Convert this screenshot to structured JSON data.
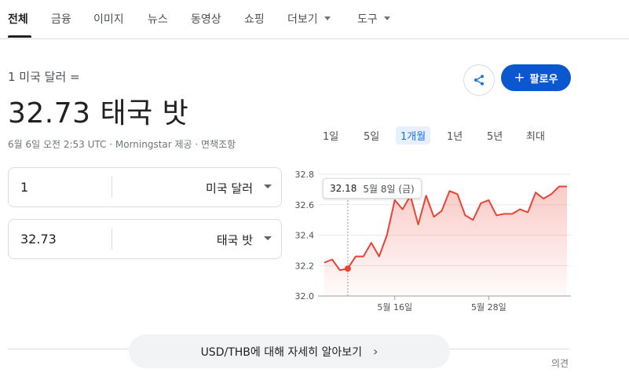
{
  "tabs": [
    {
      "label": "전체",
      "active": true
    },
    {
      "label": "금융"
    },
    {
      "label": "이미지"
    },
    {
      "label": "뉴스"
    },
    {
      "label": "동영상"
    },
    {
      "label": "쇼핑"
    },
    {
      "label": "더보기",
      "dropdown": true
    },
    {
      "label": "도구",
      "dropdown": true
    }
  ],
  "converter": {
    "from_label": "1 미국 달러 =",
    "result": "32.73 태국 밧",
    "meta": "6월 6일 오전 2:53 UTC · Morningstar 제공 · 면책조항",
    "from_value": "1",
    "from_currency": "미국 달러",
    "to_value": "32.73",
    "to_currency": "태국 밧"
  },
  "actions": {
    "share_icon": "share-icon",
    "follow_label": "팔로우"
  },
  "ranges": [
    "1일",
    "5일",
    "1개월",
    "1년",
    "5년",
    "최대"
  ],
  "active_range": "1개월",
  "tooltip": {
    "value": "32.18",
    "date": "5월 8일 (금)"
  },
  "chart_data": {
    "type": "area",
    "series": [
      {
        "values": [
          32.22,
          32.24,
          32.17,
          32.18,
          32.26,
          32.26,
          32.35,
          32.26,
          32.4,
          32.63,
          32.57,
          32.66,
          32.47,
          32.66,
          32.52,
          32.56,
          32.69,
          32.67,
          32.53,
          32.5,
          32.61,
          32.63,
          32.53,
          32.54,
          32.54,
          32.57,
          32.55,
          32.68,
          32.64,
          32.67,
          32.72,
          32.72
        ]
      }
    ],
    "highlight_index": 3,
    "y_ticks": [
      "32.8",
      "32.6",
      "32.4",
      "32.2",
      "32.0"
    ],
    "ylim": [
      32.0,
      32.8
    ],
    "x_ticks": [
      "5월 16일",
      "5월 28일"
    ],
    "grid": true,
    "line_color": "#ea4335"
  },
  "learn_more": "USD/THB에 대해 자세히 알아보기",
  "learn_more_icon": "chevron-right-icon",
  "feedback": "의견"
}
